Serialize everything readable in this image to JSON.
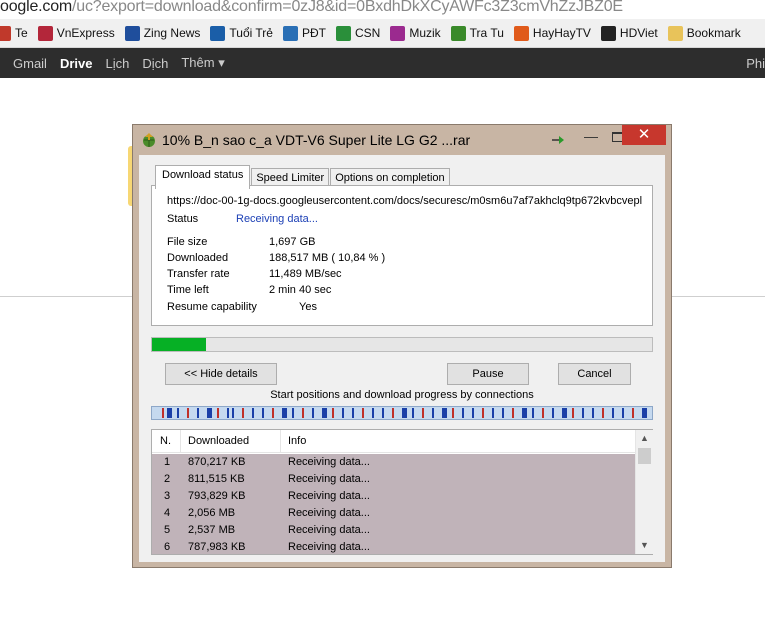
{
  "browser": {
    "url_prefix": "oogle.com",
    "url_rest": "/uc?export=download&confirm=0zJ8&id=0BxdhDkXCyAWFc3Z3cmVhZzJBZ0E",
    "bookmarks": [
      {
        "label": "Te",
        "icon": "bookmark-icon",
        "color": "#c0392b"
      },
      {
        "label": "VnExpress",
        "icon": "vnexpress-icon",
        "color": "#b3263a"
      },
      {
        "label": "Zing News",
        "icon": "zing-icon",
        "color": "#1f4e9c"
      },
      {
        "label": "Tuổi Trẻ",
        "icon": "tuoitre-icon",
        "color": "#1a5ea8"
      },
      {
        "label": "PĐT",
        "icon": "pdt-icon",
        "color": "#2a6fb5"
      },
      {
        "label": "CSN",
        "icon": "csn-icon",
        "color": "#2a8f3a"
      },
      {
        "label": "Muzik",
        "icon": "muzik-icon",
        "color": "#9b2a8f"
      },
      {
        "label": "Tra Tu",
        "icon": "tratu-icon",
        "color": "#3a8a2a"
      },
      {
        "label": "HayHayTV",
        "icon": "hayhaytv-icon",
        "color": "#e05a1a"
      },
      {
        "label": "HDViet",
        "icon": "hdviet-icon",
        "color": "#222222"
      },
      {
        "label": "Bookmark",
        "icon": "folder-icon",
        "color": "#e8c35a"
      }
    ],
    "google_nav": [
      "Gmail",
      "Drive",
      "Lịch",
      "Dịch",
      "Thêm ▾"
    ],
    "google_nav_active": "Drive",
    "google_right": "Phi"
  },
  "dialog": {
    "title": "10% B_n sao c_a VDT-V6 Super Lite LG G2 ...rar",
    "tabs": [
      "Download status",
      "Speed Limiter",
      "Options on completion"
    ],
    "url": "https://doc-00-1g-docs.googleusercontent.com/docs/securesc/m0sm6u7af7akhclq9tp672kvbcvepl",
    "status_label": "Status",
    "status_value": "Receiving data...",
    "file_size_label": "File size",
    "file_size_value": "1,697  GB",
    "downloaded_label": "Downloaded",
    "downloaded_value": "188,517  MB  ( 10,84 % )",
    "transfer_rate_label": "Transfer rate",
    "transfer_rate_value": "11,489  MB/sec",
    "time_left_label": "Time left",
    "time_left_value": "2 min 40 sec",
    "resume_label": "Resume capability",
    "resume_value": "Yes",
    "progress_percent": 10.84,
    "hide_details_label": "<< Hide details",
    "pause_label": "Pause",
    "cancel_label": "Cancel",
    "connections_label": "Start positions and download progress by connections",
    "list_headers": [
      "N.",
      "Downloaded",
      "Info"
    ],
    "connections": [
      {
        "n": "1",
        "downloaded": "870,217  KB",
        "info": "Receiving data..."
      },
      {
        "n": "2",
        "downloaded": "811,515  KB",
        "info": "Receiving data..."
      },
      {
        "n": "3",
        "downloaded": "793,829  KB",
        "info": "Receiving data..."
      },
      {
        "n": "4",
        "downloaded": "2,056  MB",
        "info": "Receiving data..."
      },
      {
        "n": "5",
        "downloaded": "2,537  MB",
        "info": "Receiving data..."
      },
      {
        "n": "6",
        "downloaded": "787,983  KB",
        "info": "Receiving data..."
      }
    ]
  }
}
